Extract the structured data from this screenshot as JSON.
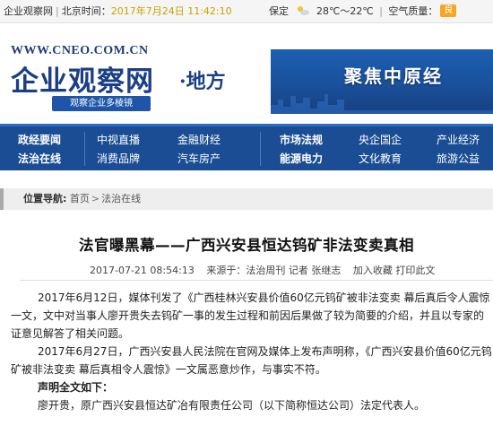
{
  "topbar": {
    "site_name": "企业观察网",
    "beijing_label": "北京时间：",
    "datetime": "2017年7月24日 11:42:10",
    "city": "保定",
    "temperature": "28℃～22℃",
    "aqi_label": "空气质量：",
    "aqi_value": "良",
    "aqi_color": "#f5a623",
    "weather_icon": "sun-cloud-icon"
  },
  "header": {
    "url": "WWW.CNEO.COM.CN",
    "logo_text": "企业观察网",
    "region_text": "·地方",
    "slogan": "观察企业多棱镜",
    "banner_text": "聚焦中原经"
  },
  "nav": {
    "columns": [
      {
        "top": "政经要闻",
        "bottom": "法治在线"
      },
      {
        "top": "中视直播",
        "bottom": "消费品牌"
      },
      {
        "top": "金融财经",
        "bottom": "汽车房产"
      },
      {
        "top": "市场法规",
        "bottom": "能源电力"
      },
      {
        "top": "央企国企",
        "bottom": "文化教育"
      },
      {
        "top": "产业经济",
        "bottom": "旅游公益"
      }
    ]
  },
  "breadcrumb": {
    "label": "位置导航:",
    "home": "首页",
    "current": "法治在线"
  },
  "article": {
    "title": "法官曝黑幕——广西兴安县恒达钨矿非法变卖真相",
    "date": "2017-07-21 08:54:13",
    "source": "来源于：法治周刊 记者 张继志",
    "favorite": "加入收藏",
    "print": "打印此文",
    "paragraphs": [
      "2017年6月12日，媒体刊发了《广西桂林兴安县价值60亿元钨矿被非法变卖 幕后真后令人震惊",
      "一文，文中对当事人廖开贵失去钨矿一事的发生过程和前因后果做了较为简要的介绍，并且以专家的",
      "证意见解答了相关问题。",
      "2017年6月27日，广西兴安县人民法院在官网及媒体上发布声明称，《广西兴安县价值60亿元钨",
      "矿被非法变卖 幕后真相令人震惊》一文属恶意炒作，与事实不符。",
      "声明全文如下：",
      "廖开贵，原广西兴安县恒达矿冶有限责任公司（以下简称恒达公司）法定代表人。"
    ]
  },
  "colors": {
    "nav_bg": "#1a4d94",
    "logo_blue": "#1b3f86",
    "time_color": "#c8a200"
  }
}
